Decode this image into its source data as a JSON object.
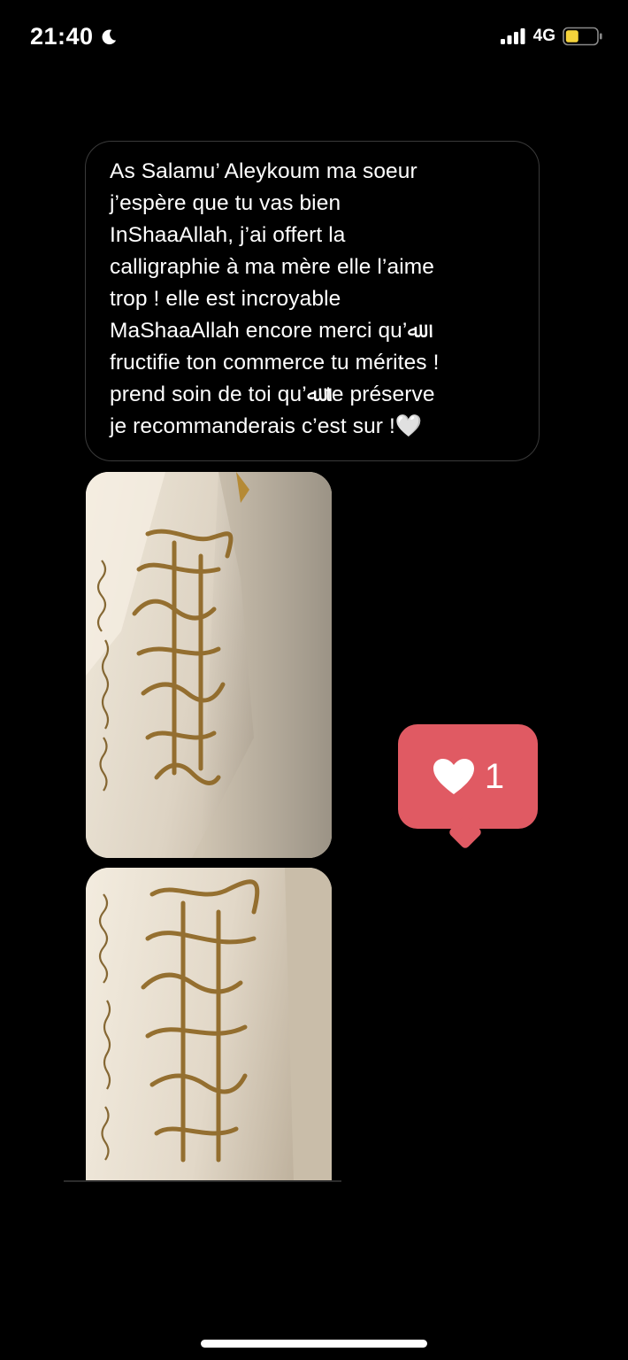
{
  "status_bar": {
    "time": "21:40",
    "network": "4G"
  },
  "message": {
    "text": "As Salamu’ Aleykoum ma soeur\nj’espère que tu vas bien\nInShaaAllah, j’ai offert la\ncalligraphie à ma mère elle l’aime\ntrop ! elle est incroyable\nMaShaaAllah encore merci qu’ﷲ\nfructifie ton commerce tu mérites !\nprend soin de toi qu’ﷲ te préserve\nje recommanderais c’est sur !🤍"
  },
  "photos": [
    {
      "name": "calligraphy-photo-1",
      "alt": "gold Arabic calligraphy on canvas"
    },
    {
      "name": "calligraphy-photo-2",
      "alt": "gold Arabic calligraphy on canvas"
    }
  ],
  "like_notification": {
    "icon": "heart-icon",
    "count": "1",
    "color": "#e05a63"
  },
  "colors": {
    "background": "#000000",
    "bubble_border": "#3a3a3a",
    "battery_level": "#f5d33b"
  }
}
